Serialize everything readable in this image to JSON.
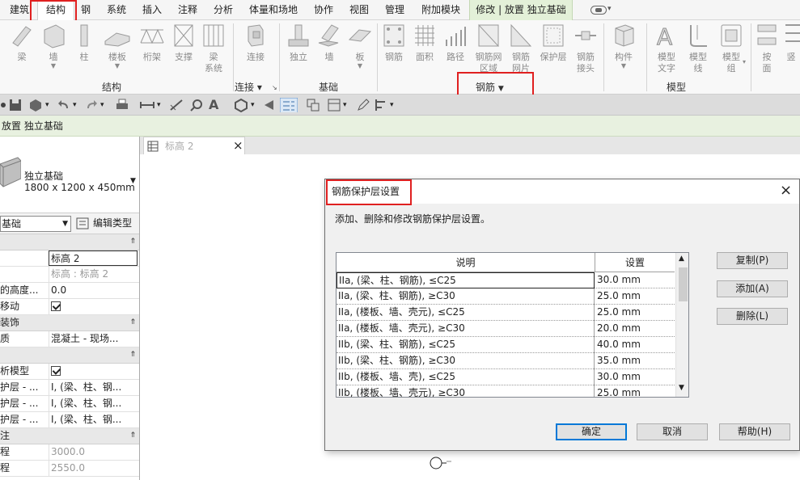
{
  "ribbon_tabs": [
    {
      "label": "建筑"
    },
    {
      "label": "结构"
    },
    {
      "label": "钢"
    },
    {
      "label": "系统"
    },
    {
      "label": "插入"
    },
    {
      "label": "注释"
    },
    {
      "label": "分析"
    },
    {
      "label": "体量和场地"
    },
    {
      "label": "协作"
    },
    {
      "label": "视图"
    },
    {
      "label": "管理"
    },
    {
      "label": "附加模块"
    },
    {
      "label": "修改 | 放置 独立基础"
    }
  ],
  "ribbon_buttons": [
    {
      "label": "梁",
      "icon": "beam-icon"
    },
    {
      "label": "墙",
      "icon": "wall-icon",
      "dropdown": true
    },
    {
      "label": "柱",
      "icon": "column-icon"
    },
    {
      "label": "楼板",
      "icon": "floor-icon",
      "dropdown": true
    },
    {
      "label": "桁架",
      "icon": "truss-icon"
    },
    {
      "label": "支撑",
      "icon": "brace-icon"
    },
    {
      "label": "梁\n系统",
      "icon": "beam-system-icon"
    },
    {
      "label": "连接",
      "icon": "connection-icon"
    },
    {
      "label": "独立",
      "icon": "isolated-foundation-icon"
    },
    {
      "label": "墙",
      "icon": "wall-foundation-icon"
    },
    {
      "label": "板",
      "icon": "slab-foundation-icon",
      "dropdown": true
    },
    {
      "label": "钢筋",
      "icon": "rebar-icon"
    },
    {
      "label": "面积",
      "icon": "area-reinforcement-icon"
    },
    {
      "label": "路径",
      "icon": "path-reinforcement-icon"
    },
    {
      "label": "钢筋网\n区域",
      "icon": "fabric-area-icon"
    },
    {
      "label": "钢筋\n网片",
      "icon": "fabric-sheet-icon"
    },
    {
      "label": "保护层",
      "icon": "cover-icon"
    },
    {
      "label": "钢筋\n接头",
      "icon": "rebar-coupler-icon"
    },
    {
      "label": "构件",
      "icon": "component-icon",
      "dropdown": true
    },
    {
      "label": "模型\n文字",
      "icon": "model-text-icon"
    },
    {
      "label": "模型\n线",
      "icon": "model-line-icon"
    },
    {
      "label": "模型\n组",
      "icon": "model-group-icon",
      "dropdown": true
    },
    {
      "label": "按\n面",
      "icon": "by-face-icon"
    },
    {
      "label": "竖",
      "icon": "shaft-icon"
    }
  ],
  "ribbon_panels": [
    {
      "label": "结构"
    },
    {
      "label": "连接 ▾"
    },
    {
      "label": "基础"
    },
    {
      "label": "钢筋"
    },
    {
      "label": "模型"
    }
  ],
  "context_bar": "放置 独立基础",
  "view_tab": {
    "label": "标高 2"
  },
  "properties": {
    "type_name": "独立基础",
    "type_size": "1800 x 1200 x 450mm",
    "selector_value": "基础",
    "edit_type_label": "编辑类型",
    "rows": [
      {
        "kind": "header",
        "label": ""
      },
      {
        "kind": "row",
        "key": "",
        "value": "标高 2",
        "editing": true
      },
      {
        "kind": "row",
        "key": "",
        "value": "标高 : 标高 2",
        "dim": true
      },
      {
        "kind": "row",
        "key": "的高度...",
        "value": "0.0"
      },
      {
        "kind": "row",
        "key": "移动",
        "check": true
      },
      {
        "kind": "header",
        "label": "装饰"
      },
      {
        "kind": "row",
        "key": "质",
        "value": "混凝土 - 现场..."
      },
      {
        "kind": "header",
        "label": ""
      },
      {
        "kind": "row",
        "key": "析模型",
        "check": true
      },
      {
        "kind": "row",
        "key": "护层 - ...",
        "value": "I, (梁、柱、钢..."
      },
      {
        "kind": "row",
        "key": "护层 - ...",
        "value": "I, (梁、柱、钢..."
      },
      {
        "kind": "row",
        "key": "护层 - ...",
        "value": "I, (梁、柱、钢..."
      },
      {
        "kind": "header",
        "label": "注"
      },
      {
        "kind": "row",
        "key": "程",
        "value": "3000.0",
        "dim": true
      },
      {
        "kind": "row",
        "key": "程",
        "value": "2550.0",
        "dim": true
      }
    ]
  },
  "dialog": {
    "title": "钢筋保护层设置",
    "description": "添加、删除和修改钢筋保护层设置。",
    "columns": {
      "desc": "说明",
      "setting": "设置"
    },
    "rows": [
      {
        "desc": "IIa, (梁、柱、钢筋), ≤C25",
        "setting": "30.0 mm"
      },
      {
        "desc": "IIa, (梁、柱、钢筋), ≥C30",
        "setting": "25.0 mm"
      },
      {
        "desc": "IIa, (楼板、墙、壳元), ≤C25",
        "setting": "25.0 mm"
      },
      {
        "desc": "IIa, (楼板、墙、壳元), ≥C30",
        "setting": "20.0 mm"
      },
      {
        "desc": "IIb, (梁、柱、钢筋), ≤C25",
        "setting": "40.0 mm"
      },
      {
        "desc": "IIb, (梁、柱、钢筋), ≥C30",
        "setting": "35.0 mm"
      },
      {
        "desc": "IIb, (楼板、墙、壳), ≤C25",
        "setting": "30.0 mm"
      },
      {
        "desc": "IIb, (楼板、墙、壳元), ≥C30",
        "setting": "25.0 mm"
      }
    ],
    "buttons": {
      "copy": "复制(P)",
      "add": "添加(A)",
      "delete": "删除(L)",
      "ok": "确定",
      "cancel": "取消",
      "help": "帮助(H)"
    }
  }
}
